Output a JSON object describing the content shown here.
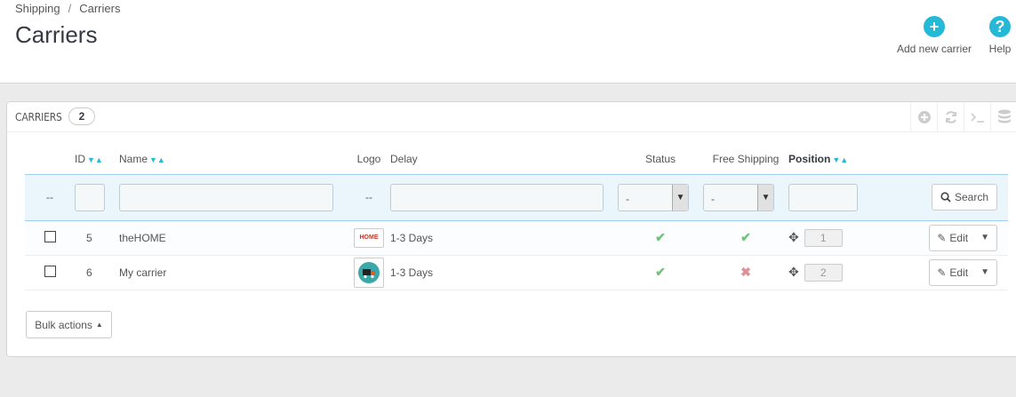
{
  "breadcrumb": {
    "parent": "Shipping",
    "separator": "/",
    "current": "Carriers"
  },
  "page_title": "Carriers",
  "toolbar": {
    "add_label": "Add new carrier",
    "help_label": "Help"
  },
  "panel": {
    "title": "CARRIERS",
    "count": "2"
  },
  "columns": {
    "id": "ID",
    "name": "Name",
    "logo": "Logo",
    "delay": "Delay",
    "status": "Status",
    "free_shipping": "Free Shipping",
    "position": "Position"
  },
  "filters": {
    "select_placeholder": "-",
    "dash": "--",
    "search_label": "Search",
    "select_dash": "-",
    "free_select_dash": "-"
  },
  "rows": [
    {
      "id": "5",
      "name": "theHOME",
      "logo_text": "HOME",
      "delay": "1-3 Days",
      "status": "enabled",
      "free_shipping": "yes",
      "position": "1"
    },
    {
      "id": "6",
      "name": "My carrier",
      "logo_text": "",
      "delay": "1-3 Days",
      "status": "enabled",
      "free_shipping": "no",
      "position": "2"
    }
  ],
  "row_actions": {
    "edit_label": "Edit"
  },
  "bulk_actions_label": "Bulk actions",
  "colors": {
    "accent": "#25b9d7",
    "check": "#72c279",
    "cross": "#e08f95"
  }
}
